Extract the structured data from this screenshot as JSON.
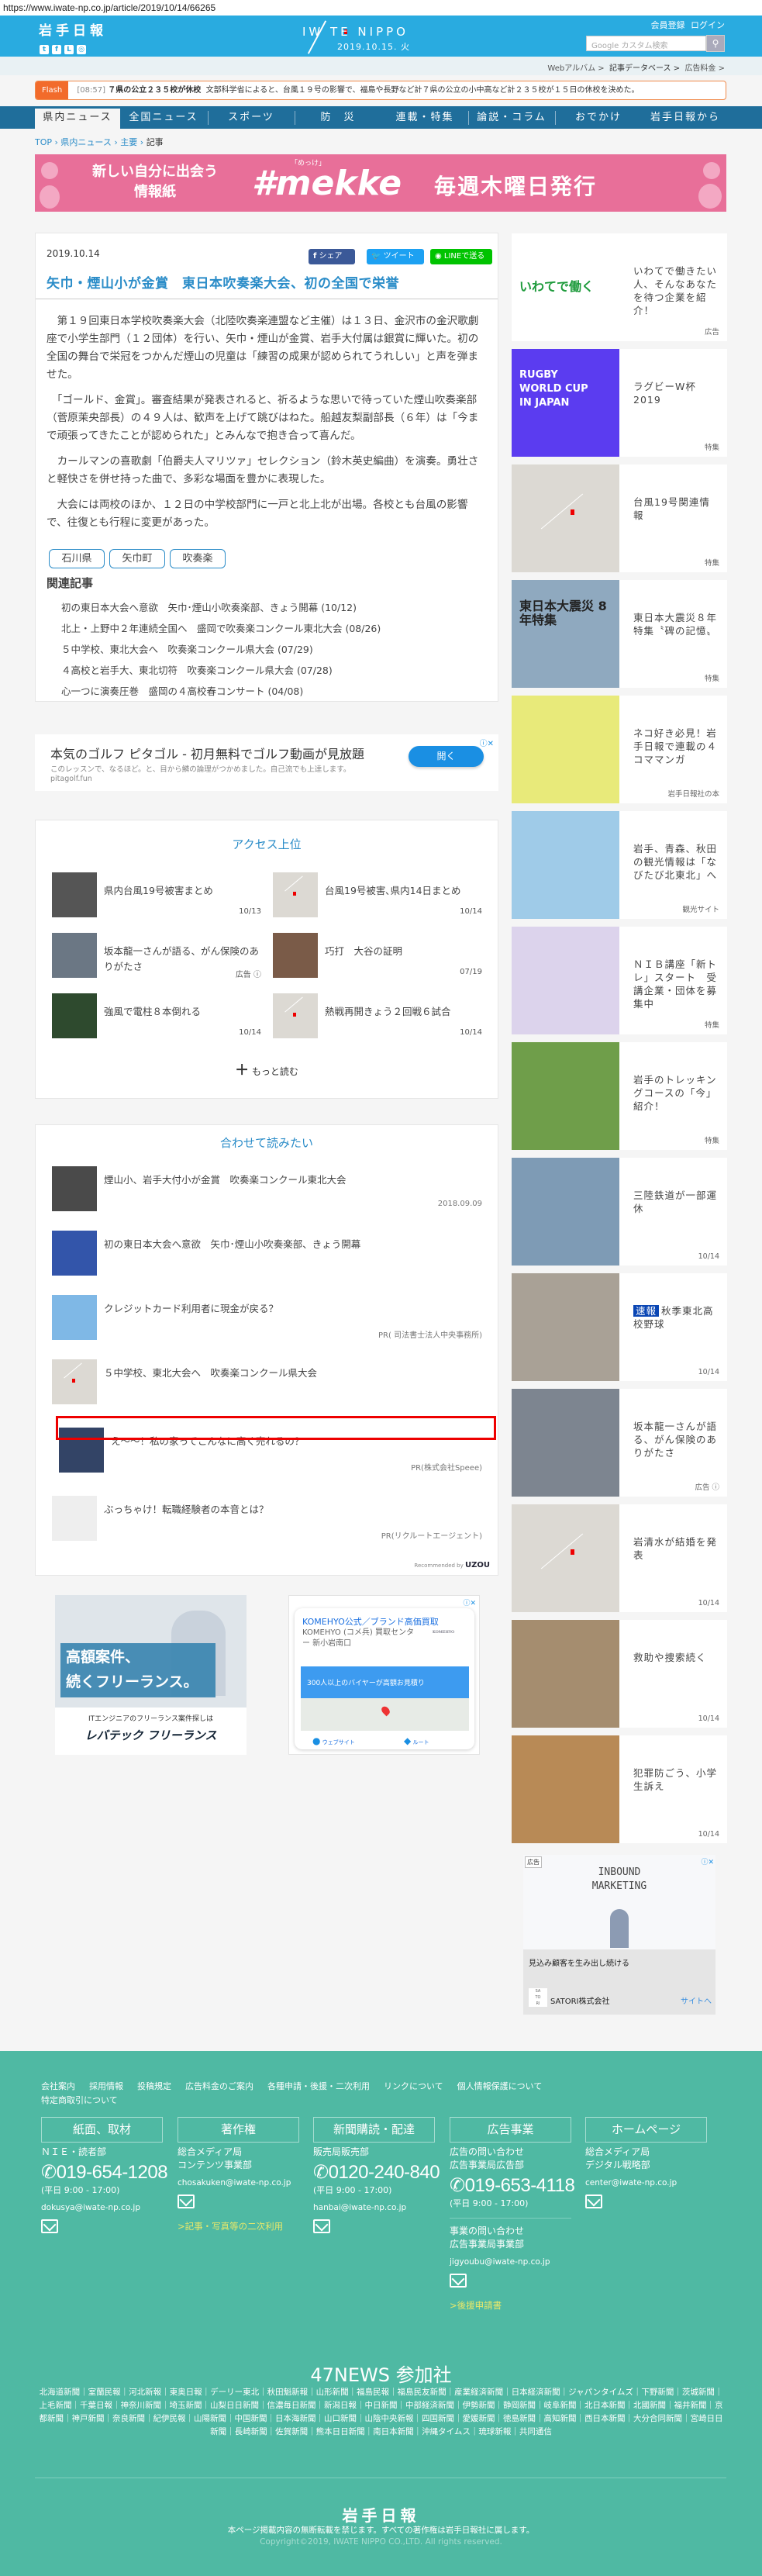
{
  "url": "https://www.iwate-np.co.jp/article/2019/10/14/66265",
  "header": {
    "logo": "岩手日報",
    "brand": "IW TE NIPPO",
    "date": "2019.10.15. 火",
    "register": "会員登録",
    "login": "ログイン",
    "search_placeholder": "Google カスタム検索"
  },
  "strip_links": [
    "Webアルバム >",
    "記事データベース >",
    "広告料金 >"
  ],
  "flash": {
    "label": "Flash",
    "time": "[08:57]",
    "headline": "７県の公立２３５校が休校",
    "body": "文部科学省によると、台風１９号の影響で、福島や長野など計７県の公立の小中高など計２３５校が１５日の休校を決めた。"
  },
  "nav": [
    "県内ニュース",
    "全国ニュース",
    "スポーツ",
    "防　災",
    "連載・特集",
    "論説・コラム",
    "おでかけ",
    "岩手日報から"
  ],
  "breadcrumb": [
    "TOP",
    "県内ニュース",
    "主要",
    "記事"
  ],
  "banner": {
    "line1": "新しい自分に出会う",
    "line2": "情報紙",
    "ruby": "「めっけ」",
    "brand": "#mekke",
    "schedule": "毎週木曜日発行"
  },
  "article": {
    "date": "2019.10.14",
    "share": "シェア",
    "tweet": "ツイート",
    "line": "LINEで送る",
    "title": "矢巾・煙山小が金賞　東日本吹奏楽大会、初の全国で栄誉",
    "paragraphs": [
      "　第１９回東日本学校吹奏楽大会（北陸吹奏楽連盟など主催）は１３日、金沢市の金沢歌劇座で小学生部門（１２団体）を行い、矢巾・煙山が金賞、岩手大付属は銀賞に輝いた。初の全国の舞台で栄冠をつかんだ煙山の児童は「練習の成果が認められてうれしい」と声を弾ませた。",
      "　「ゴールド、金賞」。審査結果が発表されると、祈るような思いで待っていた煙山吹奏楽部（菅原茉央部長）の４９人は、歓声を上げて跳びはねた。船越友梨副部長（６年）は「今まで頑張ってきたことが認められた」とみんなで抱き合って喜んだ。",
      "　カールマンの喜歌劇「伯爵夫人マリツァ」セレクション（鈴木英史編曲）を演奏。勇壮さと軽快さを併せ持った曲で、多彩な場面を豊かに表現した。",
      "　大会には両校のほか、１２日の中学校部門に一戸と北上北が出場。各校とも台風の影響で、往復とも行程に変更があった。"
    ],
    "tags": [
      "石川県",
      "矢巾町",
      "吹奏楽"
    ],
    "related_heading": "関連記事",
    "related": [
      "初の東日本大会へ意欲　矢巾･煙山小吹奏楽部、きょう開幕 (10/12)",
      "北上・上野中２年連続全国へ　盛岡で吹奏楽コンクール東北大会 (08/26)",
      "５中学校、東北大会へ　吹奏楽コンクール県大会 (07/29)",
      "４高校と岩手大、東北切符　吹奏楽コンクール県大会 (07/28)",
      "心一つに演奏圧巻　盛岡の４高校春コンサート (04/08)"
    ]
  },
  "golf_ad": {
    "title": "本気のゴルフ ピタゴル - 初月無料でゴルフ動画が見放題",
    "desc": "このレッスンで、なるほど。と、目から鱗の論理がつかめました。自己流でも上達します。",
    "domain": "pitagolf.fun",
    "button": "開く"
  },
  "access": {
    "heading": "アクセス上位",
    "items": [
      {
        "title": "県内台風19号被害まとめ",
        "meta": "10/13"
      },
      {
        "title": "台風19号被害､県内14日まとめ",
        "meta": "10/14"
      },
      {
        "title": "坂本龍一さんが語る、がん保険のありがたさ",
        "meta": "広告 ⓘ"
      },
      {
        "title": "巧打　大谷の証明",
        "meta": "07/19"
      },
      {
        "title": "強風で電柱８本倒れる",
        "meta": "10/14"
      },
      {
        "title": "熱戦再開きょう２回戦６試合",
        "meta": "10/14"
      }
    ],
    "more": "もっと読む"
  },
  "awase": {
    "heading": "合わせて読みたい",
    "items": [
      {
        "title": "煙山小、岩手大付小が金賞　吹奏楽コンクール東北大会",
        "meta": "2018.09.09"
      },
      {
        "title": "初の東日本大会へ意欲　矢巾･煙山小吹奏楽部、きょう開幕",
        "meta": ""
      },
      {
        "title": "クレジットカード利用者に現金が戻る？",
        "meta": "PR( 司法書士法人中央事務所)"
      },
      {
        "title": "５中学校、東北大会へ　吹奏楽コンクール県大会",
        "meta": ""
      },
      {
        "title": "え～～！私の家ってこんなに高く売れるの？",
        "meta": "PR(株式会社Speee)"
      },
      {
        "title": "ぶっちゃけ！転職経験者の本音とは？",
        "meta": "PR(リクルートエージェント)"
      }
    ],
    "recommended": "Recommended by",
    "recommender": "UZOU"
  },
  "ad_left": {
    "line1": "高額案件、",
    "line2": "続くフリーランス。",
    "sub": "ITエンジニアのフリーランス案件探しは",
    "brand": "レバテック フリーランス"
  },
  "ad_right": {
    "title": "KOMEHYO公式／ブランド高価買取",
    "store": "KOMEHYO (コメ兵) 買取センター 新小岩南口",
    "logo": "KOMEHYO",
    "banner": "300人以上のバイヤーが高額お見積り",
    "website": "ウェブサイト",
    "route": "ルート"
  },
  "sidebar": [
    {
      "title": "いわてで働きたい人、そんなあなたを待つ企業を紹介！",
      "label": "広告",
      "thumb": "いわてで働く",
      "color": "#ffffff"
    },
    {
      "title": "ラグビーW杯2019",
      "label": "特集",
      "thumb": "RUGBY WORLD CUP IN JAPAN",
      "color": "#5b3cf0"
    },
    {
      "title": "台風19号関連情報",
      "label": "特集",
      "thumb": "",
      "color": "placeholder"
    },
    {
      "title": "東日本大震災８年特集〝碑の記憶〟",
      "label": "特集",
      "thumb": "東日本大震災 8年特集",
      "color": "#8fa9bf"
    },
    {
      "title": "ネコ好き必見！岩手日報で連載の４コママンガ",
      "label": "岩手日報社の本",
      "thumb": "",
      "color": "#e8ea7a"
    },
    {
      "title": "岩手、青森、秋田の観光情報は「なびたび北東北」へ",
      "label": "観光サイト",
      "thumb": "",
      "color": "#9fcbe8"
    },
    {
      "title": "ＮＩＢ講座「新トレ」スタート　受講企業・団体を募集中",
      "label": "特集",
      "thumb": "",
      "color": "#dcd3ec"
    },
    {
      "title": "岩手のトレッキングコースの「今」紹介！",
      "label": "特集",
      "thumb": "",
      "color": "#6f9e4a"
    },
    {
      "title": "三陸鉄道が一部運休",
      "label": "10/14",
      "thumb": "",
      "color": "#7e9bb5"
    },
    {
      "title": "秋季東北高校野球",
      "label": "10/14",
      "badge": "速報",
      "thumb": "",
      "color": "#a9a196"
    },
    {
      "title": "坂本龍一さんが語る、がん保険のありがたさ",
      "label": "広告 ⓘ",
      "thumb": "",
      "color": "#7d8590"
    },
    {
      "title": "岩清水が結婚を発表",
      "label": "10/14",
      "thumb": "",
      "color": "placeholder"
    },
    {
      "title": "救助や捜索続く",
      "label": "10/14",
      "thumb": "",
      "color": "#a58d6f"
    },
    {
      "title": "犯罪防ごう、小学生訴え",
      "label": "10/14",
      "thumb": "",
      "color": "#b88a56"
    }
  ],
  "side_ad": {
    "badge": "広告",
    "image_text": "INBOUND MARKETING",
    "text": "見込み顧客を生み出し続ける",
    "company": "SATORI株式会社",
    "link": "サイトへ"
  },
  "footer": {
    "links": [
      "会社案内",
      "採用情報",
      "投稿規定",
      "広告料金のご案内",
      "各種申請・後援・二次利用",
      "リンクについて",
      "個人情報保護について",
      "特定商取引について"
    ],
    "cols": [
      {
        "head": "紙面、取材",
        "dept": [
          "ＮＩＥ・読者部"
        ],
        "phone": "019-654-1208",
        "hours": "(平日 9:00 - 17:00)",
        "email": "dokusya@iwate-np.co.jp"
      },
      {
        "head": "著作権",
        "dept": [
          "総合メディア局",
          "コンテンツ事業部"
        ],
        "email": "chosakuken@iwate-np.co.jp",
        "link": ">記事・写真等の二次利用"
      },
      {
        "head": "新聞購読・配達",
        "dept": [
          "販売局販売部"
        ],
        "phone": "0120-240-840",
        "hours": "(平日 9:00 - 17:00)",
        "email": "hanbai@iwate-np.co.jp"
      },
      {
        "head": "広告事業",
        "dept": [
          "広告の問い合わせ",
          "広告事業局広告部"
        ],
        "phone": "019-653-4118",
        "hours": "(平日 9:00 - 17:00)",
        "dept2": [
          "事業の問い合わせ",
          "広告事業局事業部"
        ],
        "email": "jigyoubu@iwate-np.co.jp",
        "link": ">後援申請書"
      },
      {
        "head": "ホームページ",
        "dept": [
          "総合メディア局",
          "デジタル戦略部"
        ],
        "email": "center@iwate-np.co.jp"
      }
    ],
    "news47_heading": "47NEWS 参加社",
    "news47": "北海道新聞｜室蘭民報｜河北新報｜東奥日報｜デーリー東北｜秋田魁新報｜山形新聞｜福島民報｜福島民友新聞｜産業経済新聞｜日本経済新聞｜ジャパンタイムズ｜下野新聞｜茨城新聞｜上毛新聞｜千葉日報｜神奈川新聞｜埼玉新聞｜山梨日日新聞｜信濃毎日新聞｜新潟日報｜中日新聞｜中部経済新聞｜伊勢新聞｜静岡新聞｜岐阜新聞｜北日本新聞｜北國新聞｜福井新聞｜京都新聞｜神戸新聞｜奈良新聞｜紀伊民報｜山陽新聞｜中国新聞｜日本海新聞｜山口新聞｜山陰中央新報｜四国新聞｜愛媛新聞｜徳島新聞｜高知新聞｜西日本新聞｜大分合同新聞｜宮崎日日新聞｜長崎新聞｜佐賀新聞｜熊本日日新聞｜南日本新聞｜沖縄タイムス｜琉球新報｜共同通信",
    "logo": "岩手日報",
    "notice": "本ページ掲載内容の無断転載を禁じます。すべての著作権は岩手日報社に属します。",
    "copyright": "Copyright©2019, IWATE NIPPO CO.,LTD. All rights reserved."
  },
  "colors": {
    "header": "#29abe0",
    "nav": "#1f6e9b",
    "accent": "#2a8cc8",
    "footer": "#4fb9a3",
    "flash": "#f26b2b",
    "banner": "#e86f99"
  }
}
